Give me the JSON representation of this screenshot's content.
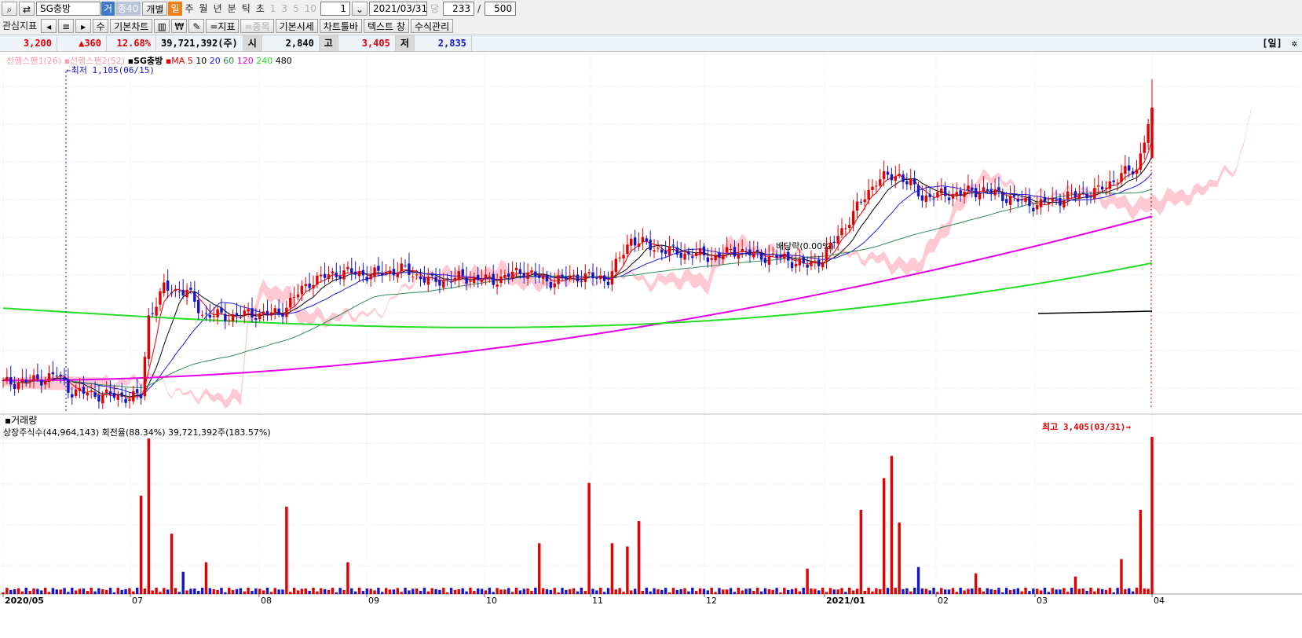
{
  "toolbar1": {
    "stock_name": "SG충방",
    "mode_labels": [
      "거",
      "종40"
    ],
    "btn_individual": "개별",
    "periods": [
      "일",
      "주",
      "월",
      "년",
      "분",
      "틱",
      "초"
    ],
    "nums": [
      "1",
      "3",
      "5",
      "10"
    ],
    "count_value": "1",
    "date_value": "2021/03/31",
    "dang": "당",
    "count1": "233",
    "slash": "/",
    "count2": "500"
  },
  "toolbar2": {
    "interest": "관심지표",
    "basic_chart": "기본차트",
    "indicator": "=지표",
    "item": "=종목",
    "basic_quote": "기본시세",
    "chart_toolbar": "차트툴바",
    "text": "텍스트 창",
    "formula": "수식관리",
    "arrows": [
      "◂",
      "≡",
      "▸",
      "수"
    ]
  },
  "info": {
    "price": "3,200",
    "change": "▲360",
    "rate": "12.68%",
    "volume": "39,721,392(주)",
    "open_label": "시",
    "open": "2,840",
    "high_label": "고",
    "high": "3,405",
    "low_label": "저",
    "low": "2,835",
    "day_label": "[일]"
  },
  "legend": {
    "span1": "선행스팬1(26)",
    "span2": "선행스팬2(52)",
    "name": "SG충방",
    "ma_label": "MA",
    "ma_periods": [
      "5",
      "10",
      "20",
      "60",
      "120",
      "240",
      "480"
    ]
  },
  "annotations": {
    "min_label": "최저 1,105(06/15)",
    "max_label": "최고 3,405(03/31)",
    "dividend": "배당락(0.00%)"
  },
  "volume_panel": {
    "title": "거래량",
    "info": "상장주식수(44,964,143) 회전율(88.34%) 39,721,392주(183.57%)"
  },
  "x_axis_labels": [
    "2020/05",
    "07",
    "08",
    "09",
    "10",
    "11",
    "12",
    "2021/01",
    "02",
    "03",
    "04"
  ],
  "chart_data": {
    "type": "candlestick",
    "indicators": [
      "ichimoku cloud (leading span 1 & 2)",
      "moving averages"
    ],
    "ma_colors": {
      "5": "#e30000",
      "10": "#000000",
      "20": "#1a1ae6",
      "60": "#2e8b57",
      "120": "#e600e6",
      "240": "#22dd22",
      "480": "#000000"
    },
    "colors": {
      "up": "#e30000",
      "down": "#1616c8",
      "cloud": "#ffc0cb"
    },
    "price_min": 1105,
    "price_max": 3405,
    "last": {
      "open": 2840,
      "high": 3405,
      "low": 2835,
      "close": 3200
    }
  }
}
